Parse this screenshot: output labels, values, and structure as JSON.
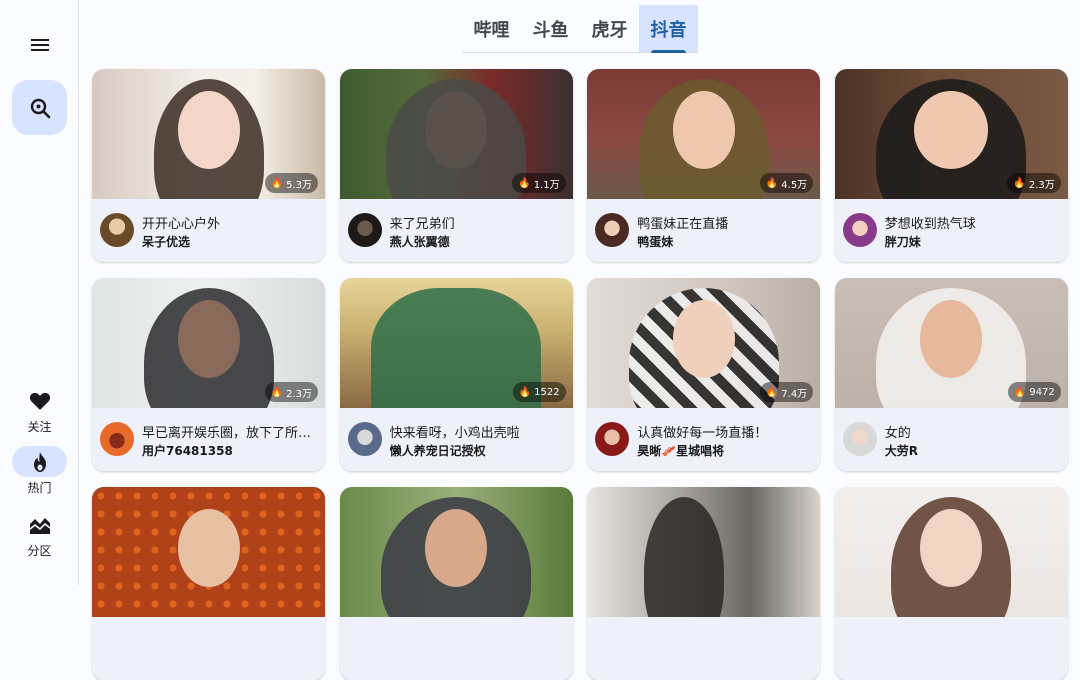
{
  "nav": {
    "items": [
      {
        "label": "关注",
        "icon": "heart-icon"
      },
      {
        "label": "热门",
        "icon": "flame-icon"
      },
      {
        "label": "分区",
        "icon": "category-icon"
      }
    ]
  },
  "tabs": [
    "哔哩",
    "斗鱼",
    "虎牙",
    "抖音"
  ],
  "active_tab": "抖音",
  "colors": {
    "accent": "#1d5fa8",
    "active_bg": "#d8e4ff",
    "card_bg": "#eef1f9"
  },
  "cards": [
    {
      "title": "开开心心户外",
      "anchor": "呆子优选",
      "viewers": "5.3万"
    },
    {
      "title": "来了兄弟们",
      "anchor": "燕人张翼德",
      "viewers": "1.1万"
    },
    {
      "title": "鸭蛋妹正在直播",
      "anchor": "鸭蛋妹",
      "viewers": "4.5万"
    },
    {
      "title": "梦想收到热气球",
      "anchor": "胖刀妹",
      "viewers": "2.3万"
    },
    {
      "title": "早已离开娱乐圈，放下了所有...",
      "anchor": "用户76481358",
      "viewers": "2.3万"
    },
    {
      "title": "快来看呀，小鸡出壳啦",
      "anchor": "懒人养宠日记授权",
      "viewers": "1522"
    },
    {
      "title": "认真做好每一场直播！",
      "anchor": "昊晰🥓星城唱将",
      "viewers": "7.4万"
    },
    {
      "title": "女的",
      "anchor": "大劳R",
      "viewers": "9472"
    },
    {
      "title": "",
      "anchor": "",
      "viewers": ""
    },
    {
      "title": "",
      "anchor": "",
      "viewers": ""
    },
    {
      "title": "",
      "anchor": "",
      "viewers": ""
    },
    {
      "title": "",
      "anchor": "",
      "viewers": ""
    }
  ]
}
